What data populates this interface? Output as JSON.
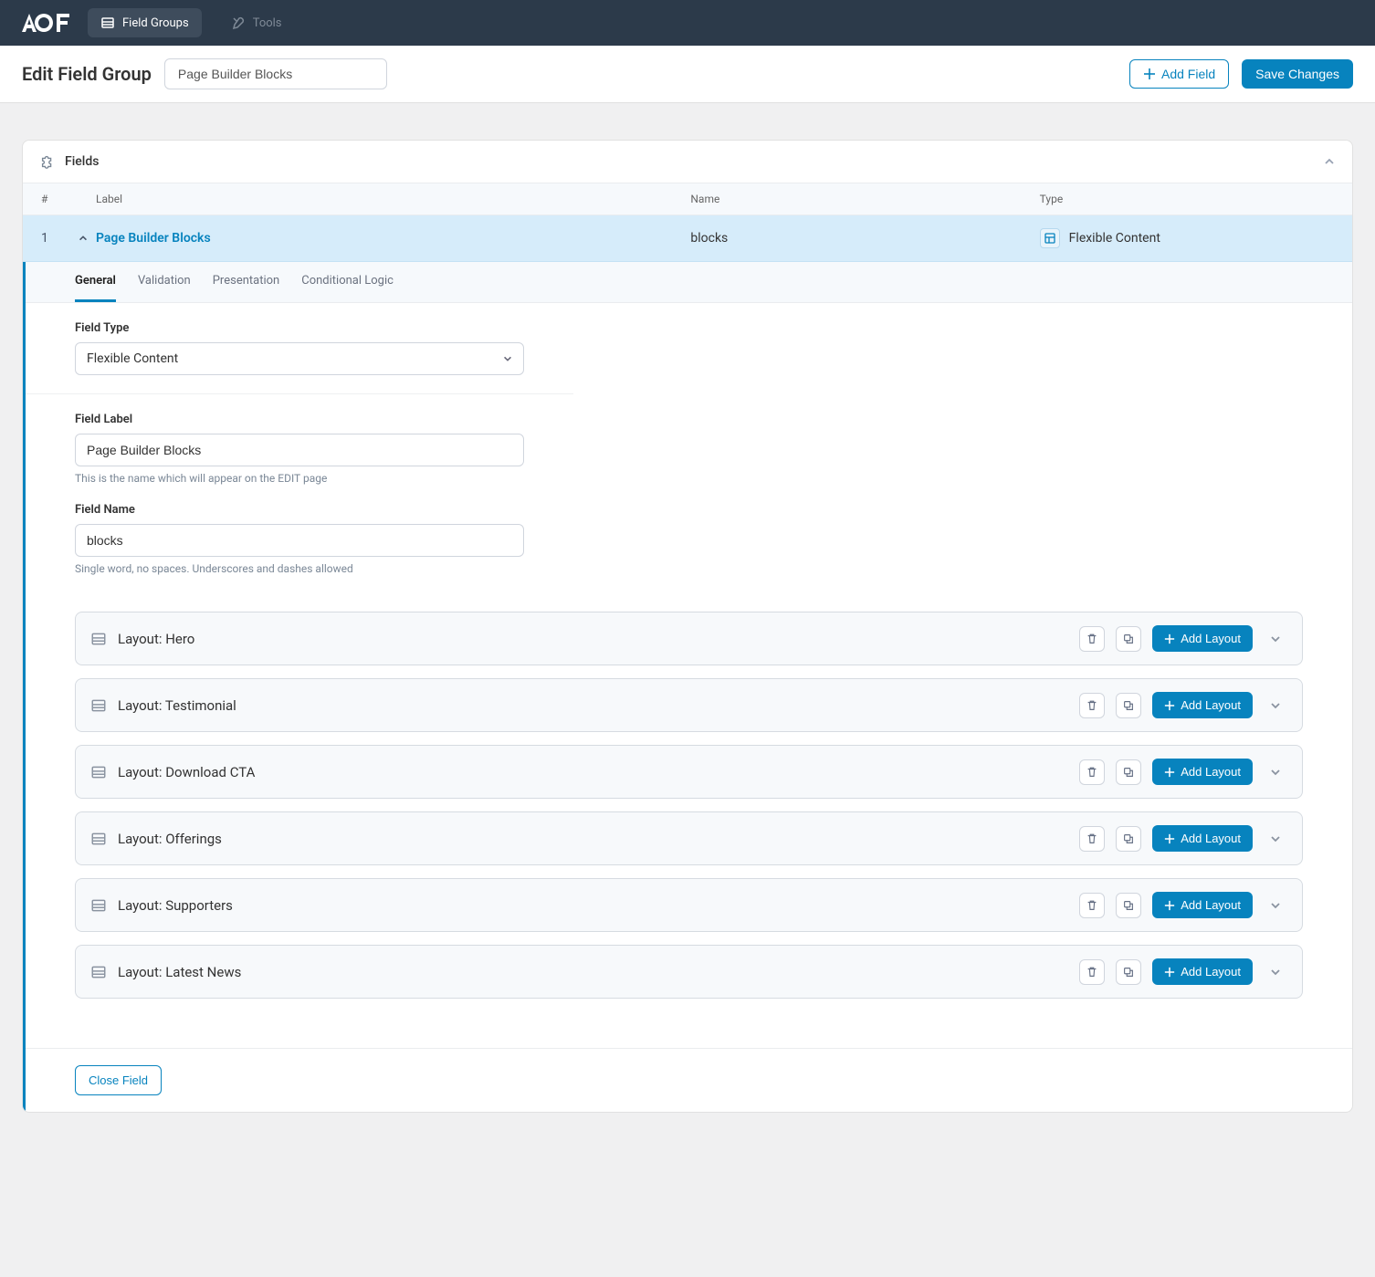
{
  "topbar": {
    "nav": {
      "field_groups": "Field Groups",
      "tools": "Tools"
    }
  },
  "header": {
    "page_title": "Edit Field Group",
    "title_input": "Page Builder Blocks",
    "add_field": "Add Field",
    "save_changes": "Save Changes"
  },
  "panel": {
    "title": "Fields",
    "columns": {
      "num": "#",
      "label": "Label",
      "name": "Name",
      "type": "Type"
    },
    "field": {
      "num": "1",
      "label": "Page Builder Blocks",
      "name": "blocks",
      "type": "Flexible Content"
    }
  },
  "editor": {
    "tabs": {
      "general": "General",
      "validation": "Validation",
      "presentation": "Presentation",
      "conditional": "Conditional Logic"
    },
    "field_type": {
      "label": "Field Type",
      "value": "Flexible Content"
    },
    "field_label": {
      "label": "Field Label",
      "value": "Page Builder Blocks",
      "help": "This is the name which will appear on the EDIT page"
    },
    "field_name": {
      "label": "Field Name",
      "value": "blocks",
      "help": "Single word, no spaces. Underscores and dashes allowed"
    },
    "add_layout": "Add Layout",
    "layouts": [
      {
        "title": "Layout: Hero"
      },
      {
        "title": "Layout: Testimonial"
      },
      {
        "title": "Layout: Download CTA"
      },
      {
        "title": "Layout: Offerings"
      },
      {
        "title": "Layout: Supporters"
      },
      {
        "title": "Layout: Latest News"
      }
    ],
    "close_field": "Close Field"
  }
}
